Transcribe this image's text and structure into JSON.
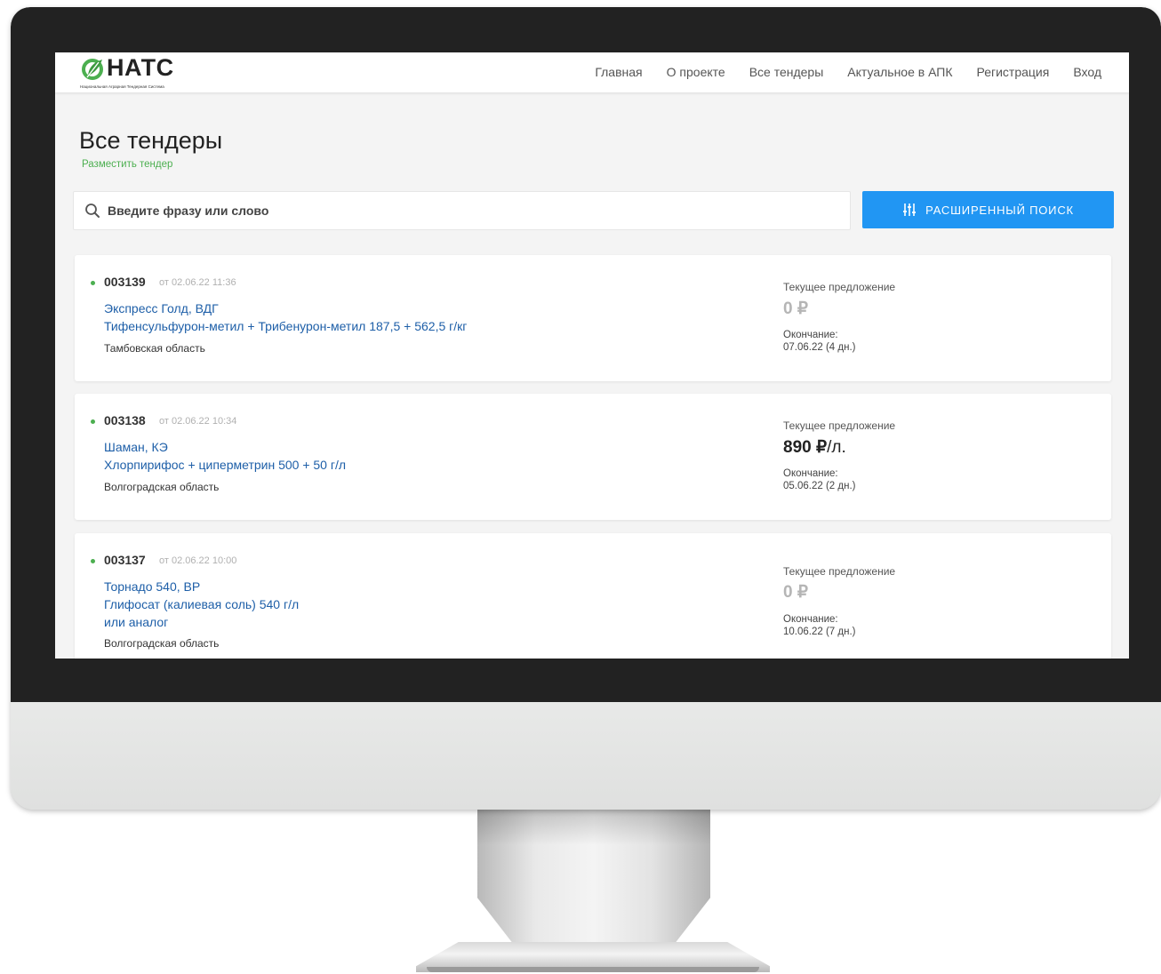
{
  "brand": {
    "name": "НАТС",
    "subtitle": "Национальная Аграрная Тендерная Система",
    "colors": {
      "green": "#4caf50",
      "blue": "#2196f3",
      "link": "#1e5fa8"
    }
  },
  "nav": [
    {
      "label": "Главная"
    },
    {
      "label": "О проекте"
    },
    {
      "label": "Все тендеры"
    },
    {
      "label": "Актуальное в АПК"
    },
    {
      "label": "Регистрация"
    },
    {
      "label": "Вход"
    }
  ],
  "page": {
    "title": "Все тендеры",
    "place_tender_link": "Разместить тендер"
  },
  "search": {
    "placeholder": "Введите фразу или слово",
    "icon": "search-icon"
  },
  "advanced_search": {
    "label": "РАСШИРЕННЫЙ ПОИСК",
    "icon": "sliders-icon"
  },
  "tenders": [
    {
      "number": "003139",
      "date": "от 02.06.22 11:36",
      "titles": [
        "Экспресс Голд, ВДГ",
        "Тифенсульфурон-метил + Трибенурон-метил 187,5 + 562,5 г/кг"
      ],
      "region": "Тамбовская область",
      "offer_label": "Текущее предложение",
      "price": "0 ₽",
      "price_unit": "",
      "end_label": "Окончание:",
      "end_value": "07.06.22 (4 дн.)"
    },
    {
      "number": "003138",
      "date": "от 02.06.22 10:34",
      "titles": [
        "Шаман, КЭ",
        "Хлорпирифос + циперметрин 500 + 50 г/л"
      ],
      "region": "Волгоградская область",
      "offer_label": "Текущее предложение",
      "price": "890 ₽",
      "price_unit": "/л.",
      "end_label": "Окончание:",
      "end_value": "05.06.22 (2 дн.)"
    },
    {
      "number": "003137",
      "date": "от 02.06.22 10:00",
      "titles": [
        "Торнадо 540, ВР",
        "Глифосат (калиевая соль) 540 г/л",
        "или аналог"
      ],
      "region": "Волгоградская область",
      "offer_label": "Текущее предложение",
      "price": "0 ₽",
      "price_unit": "",
      "end_label": "Окончание:",
      "end_value": "10.06.22 (7 дн.)"
    }
  ]
}
